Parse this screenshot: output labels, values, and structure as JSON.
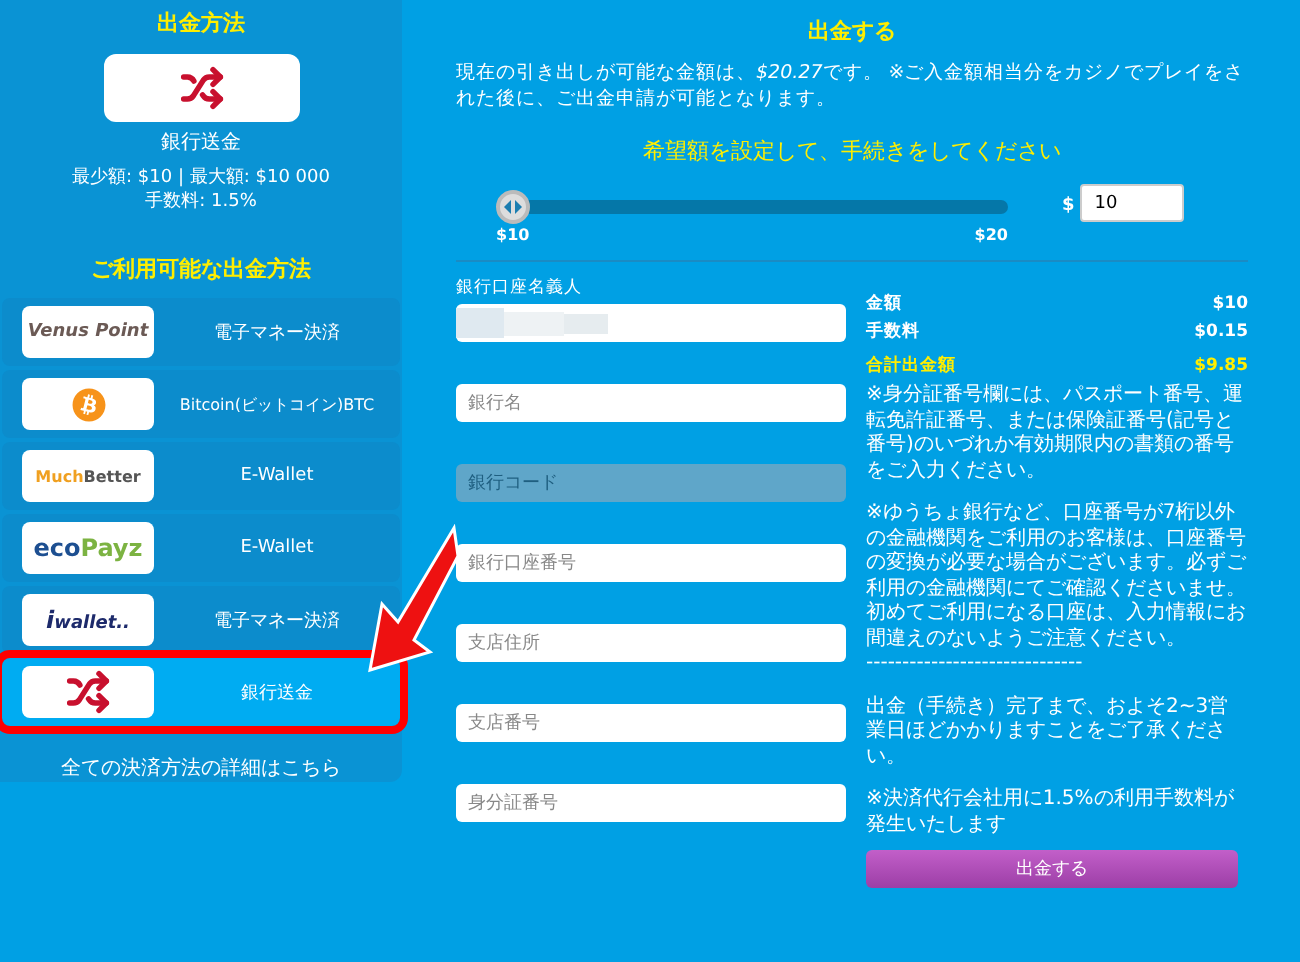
{
  "sidebar": {
    "title": "出金方法",
    "current": {
      "kind": "shuffle",
      "name": "銀行送金",
      "limits": "最少額: $10 | 最大額: $10 000",
      "fee": "手数料: 1.5%"
    },
    "available_title": "ご利用可能な出金方法",
    "methods": [
      {
        "kind": "venus",
        "logo_parts": [
          "Venus Point"
        ],
        "label": "電子マネー決済",
        "selected": false,
        "highlighted": false
      },
      {
        "kind": "bitcoin",
        "label": "Bitcoin(ビットコイン)BTC",
        "selected": false,
        "highlighted": false
      },
      {
        "kind": "muchbetter",
        "logo_parts": [
          "Much",
          "Better"
        ],
        "label": "E-Wallet",
        "selected": false,
        "highlighted": false
      },
      {
        "kind": "ecopayz",
        "logo_parts": [
          "eco",
          "Payz"
        ],
        "label": "E-Wallet",
        "selected": false,
        "highlighted": false
      },
      {
        "kind": "iwallet",
        "logo_parts": [
          "i",
          "wallet.."
        ],
        "label": "電子マネー決済",
        "selected": false,
        "highlighted": false
      },
      {
        "kind": "shuffle",
        "label": "銀行送金",
        "selected": true,
        "highlighted": true
      }
    ],
    "details_link": "全ての決済方法の詳細はこちら"
  },
  "withdraw": {
    "title": "出金する",
    "intro_parts": [
      "現在の引き出しが可能な金額は、",
      "$20.27",
      "です。 ※ご入金額相当分をカジノでプレイをされた後に、ご出金申請が可能となります。"
    ],
    "subtitle": "希望額を設定して、手続きをしてください",
    "slider": {
      "level": 0,
      "min_label": "$10",
      "max_label": "$20"
    },
    "amount": {
      "currency": "$",
      "value": "10"
    },
    "fields": [
      {
        "kind": "redacted",
        "label": "銀行口座名義人",
        "disabled": false
      },
      {
        "kind": "text",
        "placeholder": "銀行名",
        "disabled": false
      },
      {
        "kind": "text",
        "placeholder": "銀行コード",
        "disabled": true
      },
      {
        "kind": "text",
        "placeholder": "銀行口座番号",
        "disabled": false
      },
      {
        "kind": "text",
        "placeholder": "支店住所",
        "disabled": false
      },
      {
        "kind": "text",
        "placeholder": "支店番号",
        "disabled": false
      },
      {
        "kind": "text",
        "placeholder": "身分証番号",
        "disabled": false
      }
    ],
    "summary": [
      {
        "label": "金額",
        "value": "$10",
        "total": false
      },
      {
        "label": "手数料",
        "value": "$0.15",
        "total": false
      },
      {
        "label": "合計出金額",
        "value": "$9.85",
        "total": true
      }
    ],
    "notes": [
      "※身分証番号欄には、パスポート番号、運転免許証番号、または保険証番号(記号と番号)のいづれか有効期限内の書類の番号をご入力ください。",
      "※ゆうちょ銀行など、口座番号が7桁以外の金融機関をご利用のお客様は、口座番号の変換が必要な場合がございます。必ずご利用の金融機関にてご確認くださいませ。初めてご利用になる口座は、入力情報にお間違えのないようご注意ください。",
      "------------------------------",
      "出金（手続き）完了まで、およそ2~3営業日ほどかかりますことをご了承ください。",
      "※決済代行会社用に1.5%の利用手数料が発生いたします"
    ],
    "submit": "出金する"
  }
}
